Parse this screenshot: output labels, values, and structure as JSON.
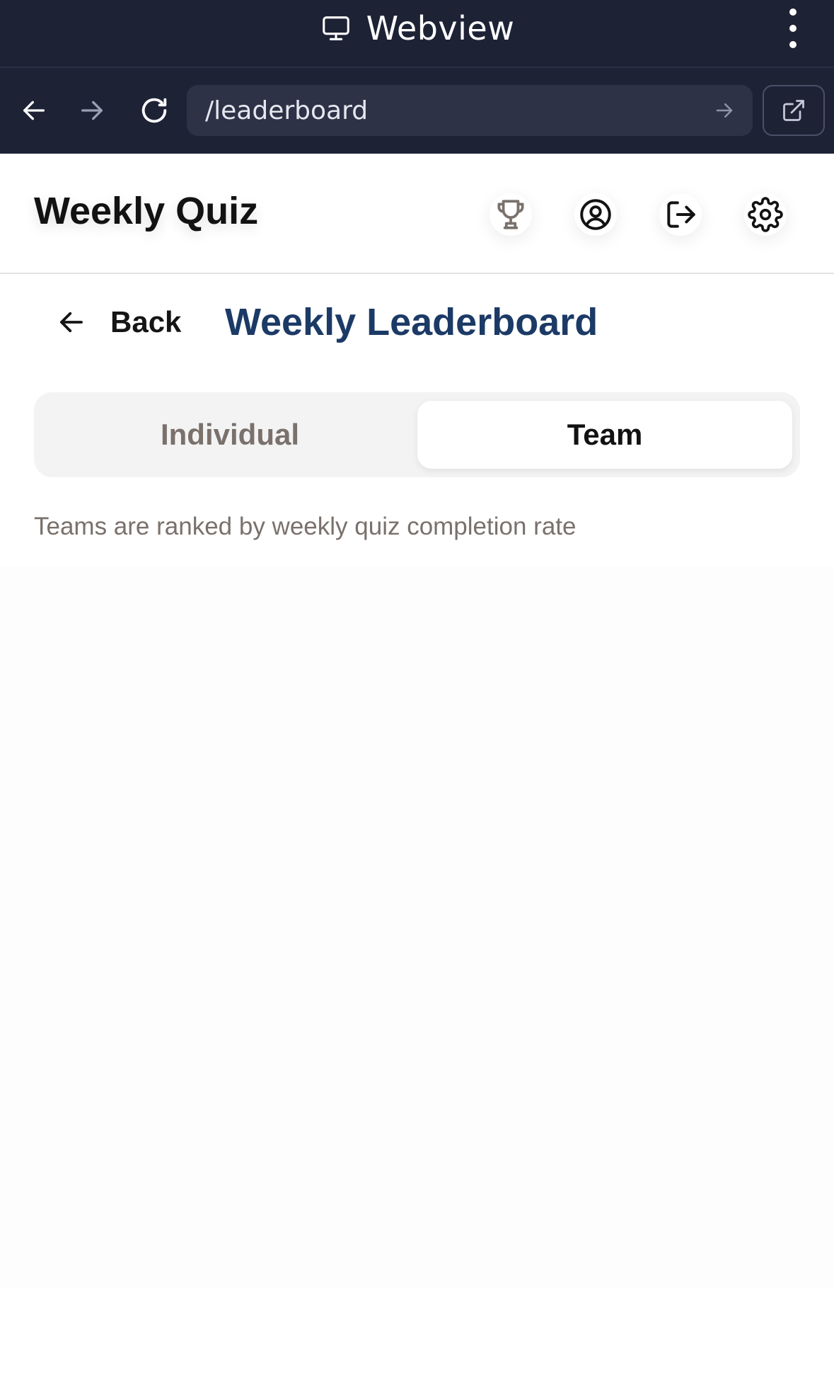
{
  "webview": {
    "title": "Webview",
    "title_icon": "monitor-icon",
    "menu_icon": "more-vertical-icon"
  },
  "nav": {
    "url": "/leaderboard",
    "back_icon": "arrow-left-icon",
    "forward_icon": "arrow-right-icon",
    "reload_icon": "refresh-icon",
    "go_icon": "arrow-right-icon",
    "open_external_icon": "external-link-icon"
  },
  "header": {
    "title": "Weekly Quiz",
    "icons": [
      "trophy-icon",
      "user-circle-icon",
      "logout-icon",
      "gear-icon"
    ]
  },
  "page": {
    "back_label": "Back",
    "title": "Weekly Leaderboard"
  },
  "tabs": [
    {
      "label": "Individual",
      "active": false
    },
    {
      "label": "Team",
      "active": true
    }
  ],
  "info": "Teams are ranked by weekly quiz completion rate",
  "colors": {
    "webview_bg": "#1e2235",
    "url_bg": "#2d3247",
    "page_title": "#1c3a66",
    "muted_text": "#7a716c",
    "trophy": "#7a716c"
  }
}
